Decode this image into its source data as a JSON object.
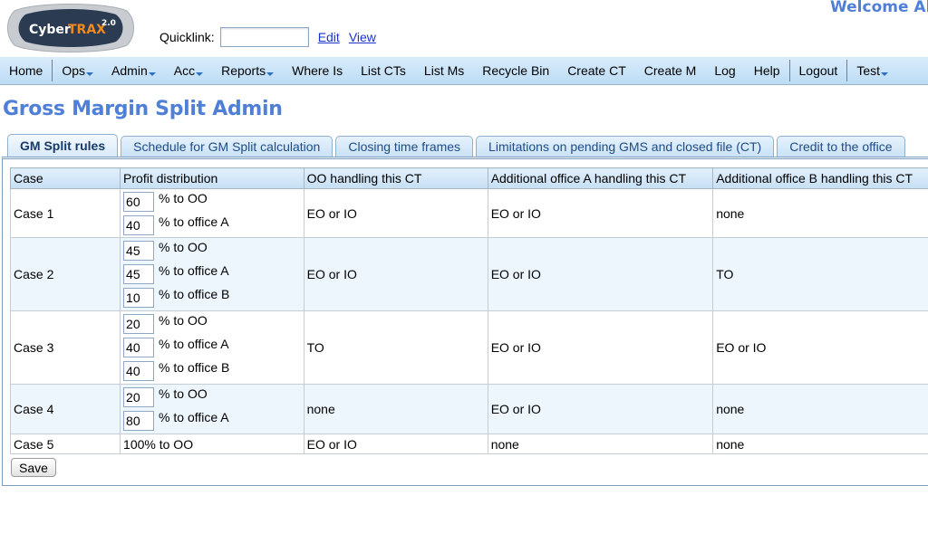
{
  "header": {
    "logo": {
      "brand": "Cyber",
      "brand_accent": "TRAX",
      "version": "2.0"
    },
    "quicklink": {
      "label": "Quicklink:",
      "value": "",
      "placeholder": "",
      "edit_link": "Edit",
      "view_link": "View"
    },
    "welcome": "Welcome Ale"
  },
  "nav": {
    "items": [
      {
        "label": "Home",
        "dropdown": false
      },
      {
        "label": "Ops",
        "dropdown": true
      },
      {
        "label": "Admin",
        "dropdown": true
      },
      {
        "label": "Acc",
        "dropdown": true
      },
      {
        "label": "Reports",
        "dropdown": true
      },
      {
        "label": "Where Is",
        "dropdown": false
      },
      {
        "label": "List CTs",
        "dropdown": false
      },
      {
        "label": "List Ms",
        "dropdown": false
      },
      {
        "label": "Recycle Bin",
        "dropdown": false
      },
      {
        "label": "Create CT",
        "dropdown": false
      },
      {
        "label": "Create M",
        "dropdown": false
      },
      {
        "label": "Log",
        "dropdown": false
      },
      {
        "label": "Help",
        "dropdown": false
      },
      {
        "label": "Logout",
        "dropdown": false
      },
      {
        "label": "Test",
        "dropdown": true
      }
    ]
  },
  "page": {
    "title": "Gross Margin Split Admin"
  },
  "tabs": [
    {
      "label": "GM Split rules",
      "active": true
    },
    {
      "label": "Schedule for GM Split calculation",
      "active": false
    },
    {
      "label": "Closing time frames",
      "active": false
    },
    {
      "label": "Limitations on pending GMS and closed file (CT)",
      "active": false
    },
    {
      "label": "Credit to the office",
      "active": false
    }
  ],
  "table": {
    "columns": [
      "Case",
      "Profit distribution",
      "OO handling this CT",
      "Additional office A handling this CT",
      "Additional office B handling this CT"
    ],
    "rows": [
      {
        "case": "Case 1",
        "distribution": [
          {
            "value": "60",
            "label": "% to OO"
          },
          {
            "value": "40",
            "label": "% to office A"
          }
        ],
        "oo": "EO or IO",
        "office_a": "EO or IO",
        "office_b": "none"
      },
      {
        "case": "Case 2",
        "distribution": [
          {
            "value": "45",
            "label": "% to OO"
          },
          {
            "value": "45",
            "label": "% to office A"
          },
          {
            "value": "10",
            "label": "% to office B"
          }
        ],
        "oo": "EO or IO",
        "office_a": "EO or IO",
        "office_b": "TO"
      },
      {
        "case": "Case 3",
        "distribution": [
          {
            "value": "20",
            "label": "% to OO"
          },
          {
            "value": "40",
            "label": "% to office A"
          },
          {
            "value": "40",
            "label": "% to office B"
          }
        ],
        "oo": "TO",
        "office_a": "EO or IO",
        "office_b": "EO or IO"
      },
      {
        "case": "Case 4",
        "distribution": [
          {
            "value": "20",
            "label": "% to OO"
          },
          {
            "value": "80",
            "label": "% to office A"
          }
        ],
        "oo": "none",
        "office_a": "EO or IO",
        "office_b": "none"
      },
      {
        "case": "Case 5",
        "distribution_text": "100% to OO",
        "oo": "EO or IO",
        "office_a": "none",
        "office_b": "none"
      }
    ]
  },
  "actions": {
    "save_label": "Save"
  },
  "colors": {
    "title": "#4f7fd6",
    "nav_bg": "#c9e3f7",
    "link": "#1a33cc",
    "logo_accent": "#f08a1c"
  }
}
